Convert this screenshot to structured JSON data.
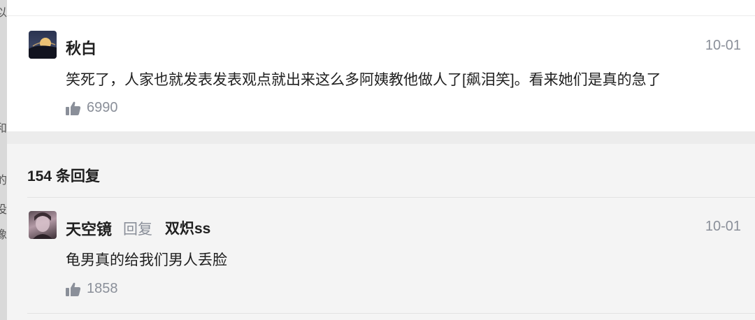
{
  "left_strip_fragments": [
    "以",
    "和",
    "的",
    "没",
    "像"
  ],
  "main_comment": {
    "username": "秋白",
    "time": "10-01",
    "content": "笑死了，人家也就发表发表观点就出来这么多阿姨教他做人了[飙泪笑]。看来她们是真的急了",
    "likes": "6990"
  },
  "replies": {
    "count_label": "154 条回复",
    "items": [
      {
        "username": "天空镜",
        "reply_word": "回复",
        "reply_to": "双炽ss",
        "time": "10-01",
        "content": "龟男真的给我们男人丢脸",
        "likes": "1858"
      }
    ]
  },
  "icons": {
    "like": "thumbs-up-icon"
  },
  "colors": {
    "meta": "#8a8f99",
    "text": "#1f1f1f",
    "bg": "#f4f4f4"
  }
}
